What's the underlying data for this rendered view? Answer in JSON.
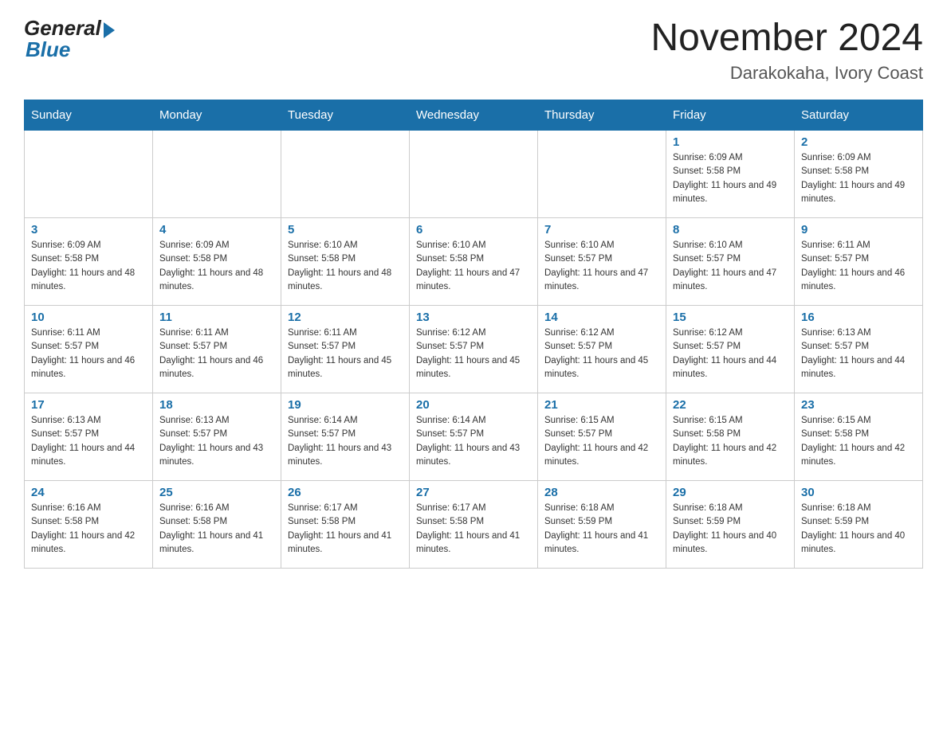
{
  "header": {
    "logo_general": "General",
    "logo_blue": "Blue",
    "month_year": "November 2024",
    "location": "Darakokaha, Ivory Coast"
  },
  "days_of_week": [
    "Sunday",
    "Monday",
    "Tuesday",
    "Wednesday",
    "Thursday",
    "Friday",
    "Saturday"
  ],
  "weeks": [
    [
      {
        "day": "",
        "info": ""
      },
      {
        "day": "",
        "info": ""
      },
      {
        "day": "",
        "info": ""
      },
      {
        "day": "",
        "info": ""
      },
      {
        "day": "",
        "info": ""
      },
      {
        "day": "1",
        "info": "Sunrise: 6:09 AM\nSunset: 5:58 PM\nDaylight: 11 hours and 49 minutes."
      },
      {
        "day": "2",
        "info": "Sunrise: 6:09 AM\nSunset: 5:58 PM\nDaylight: 11 hours and 49 minutes."
      }
    ],
    [
      {
        "day": "3",
        "info": "Sunrise: 6:09 AM\nSunset: 5:58 PM\nDaylight: 11 hours and 48 minutes."
      },
      {
        "day": "4",
        "info": "Sunrise: 6:09 AM\nSunset: 5:58 PM\nDaylight: 11 hours and 48 minutes."
      },
      {
        "day": "5",
        "info": "Sunrise: 6:10 AM\nSunset: 5:58 PM\nDaylight: 11 hours and 48 minutes."
      },
      {
        "day": "6",
        "info": "Sunrise: 6:10 AM\nSunset: 5:58 PM\nDaylight: 11 hours and 47 minutes."
      },
      {
        "day": "7",
        "info": "Sunrise: 6:10 AM\nSunset: 5:57 PM\nDaylight: 11 hours and 47 minutes."
      },
      {
        "day": "8",
        "info": "Sunrise: 6:10 AM\nSunset: 5:57 PM\nDaylight: 11 hours and 47 minutes."
      },
      {
        "day": "9",
        "info": "Sunrise: 6:11 AM\nSunset: 5:57 PM\nDaylight: 11 hours and 46 minutes."
      }
    ],
    [
      {
        "day": "10",
        "info": "Sunrise: 6:11 AM\nSunset: 5:57 PM\nDaylight: 11 hours and 46 minutes."
      },
      {
        "day": "11",
        "info": "Sunrise: 6:11 AM\nSunset: 5:57 PM\nDaylight: 11 hours and 46 minutes."
      },
      {
        "day": "12",
        "info": "Sunrise: 6:11 AM\nSunset: 5:57 PM\nDaylight: 11 hours and 45 minutes."
      },
      {
        "day": "13",
        "info": "Sunrise: 6:12 AM\nSunset: 5:57 PM\nDaylight: 11 hours and 45 minutes."
      },
      {
        "day": "14",
        "info": "Sunrise: 6:12 AM\nSunset: 5:57 PM\nDaylight: 11 hours and 45 minutes."
      },
      {
        "day": "15",
        "info": "Sunrise: 6:12 AM\nSunset: 5:57 PM\nDaylight: 11 hours and 44 minutes."
      },
      {
        "day": "16",
        "info": "Sunrise: 6:13 AM\nSunset: 5:57 PM\nDaylight: 11 hours and 44 minutes."
      }
    ],
    [
      {
        "day": "17",
        "info": "Sunrise: 6:13 AM\nSunset: 5:57 PM\nDaylight: 11 hours and 44 minutes."
      },
      {
        "day": "18",
        "info": "Sunrise: 6:13 AM\nSunset: 5:57 PM\nDaylight: 11 hours and 43 minutes."
      },
      {
        "day": "19",
        "info": "Sunrise: 6:14 AM\nSunset: 5:57 PM\nDaylight: 11 hours and 43 minutes."
      },
      {
        "day": "20",
        "info": "Sunrise: 6:14 AM\nSunset: 5:57 PM\nDaylight: 11 hours and 43 minutes."
      },
      {
        "day": "21",
        "info": "Sunrise: 6:15 AM\nSunset: 5:57 PM\nDaylight: 11 hours and 42 minutes."
      },
      {
        "day": "22",
        "info": "Sunrise: 6:15 AM\nSunset: 5:58 PM\nDaylight: 11 hours and 42 minutes."
      },
      {
        "day": "23",
        "info": "Sunrise: 6:15 AM\nSunset: 5:58 PM\nDaylight: 11 hours and 42 minutes."
      }
    ],
    [
      {
        "day": "24",
        "info": "Sunrise: 6:16 AM\nSunset: 5:58 PM\nDaylight: 11 hours and 42 minutes."
      },
      {
        "day": "25",
        "info": "Sunrise: 6:16 AM\nSunset: 5:58 PM\nDaylight: 11 hours and 41 minutes."
      },
      {
        "day": "26",
        "info": "Sunrise: 6:17 AM\nSunset: 5:58 PM\nDaylight: 11 hours and 41 minutes."
      },
      {
        "day": "27",
        "info": "Sunrise: 6:17 AM\nSunset: 5:58 PM\nDaylight: 11 hours and 41 minutes."
      },
      {
        "day": "28",
        "info": "Sunrise: 6:18 AM\nSunset: 5:59 PM\nDaylight: 11 hours and 41 minutes."
      },
      {
        "day": "29",
        "info": "Sunrise: 6:18 AM\nSunset: 5:59 PM\nDaylight: 11 hours and 40 minutes."
      },
      {
        "day": "30",
        "info": "Sunrise: 6:18 AM\nSunset: 5:59 PM\nDaylight: 11 hours and 40 minutes."
      }
    ]
  ]
}
